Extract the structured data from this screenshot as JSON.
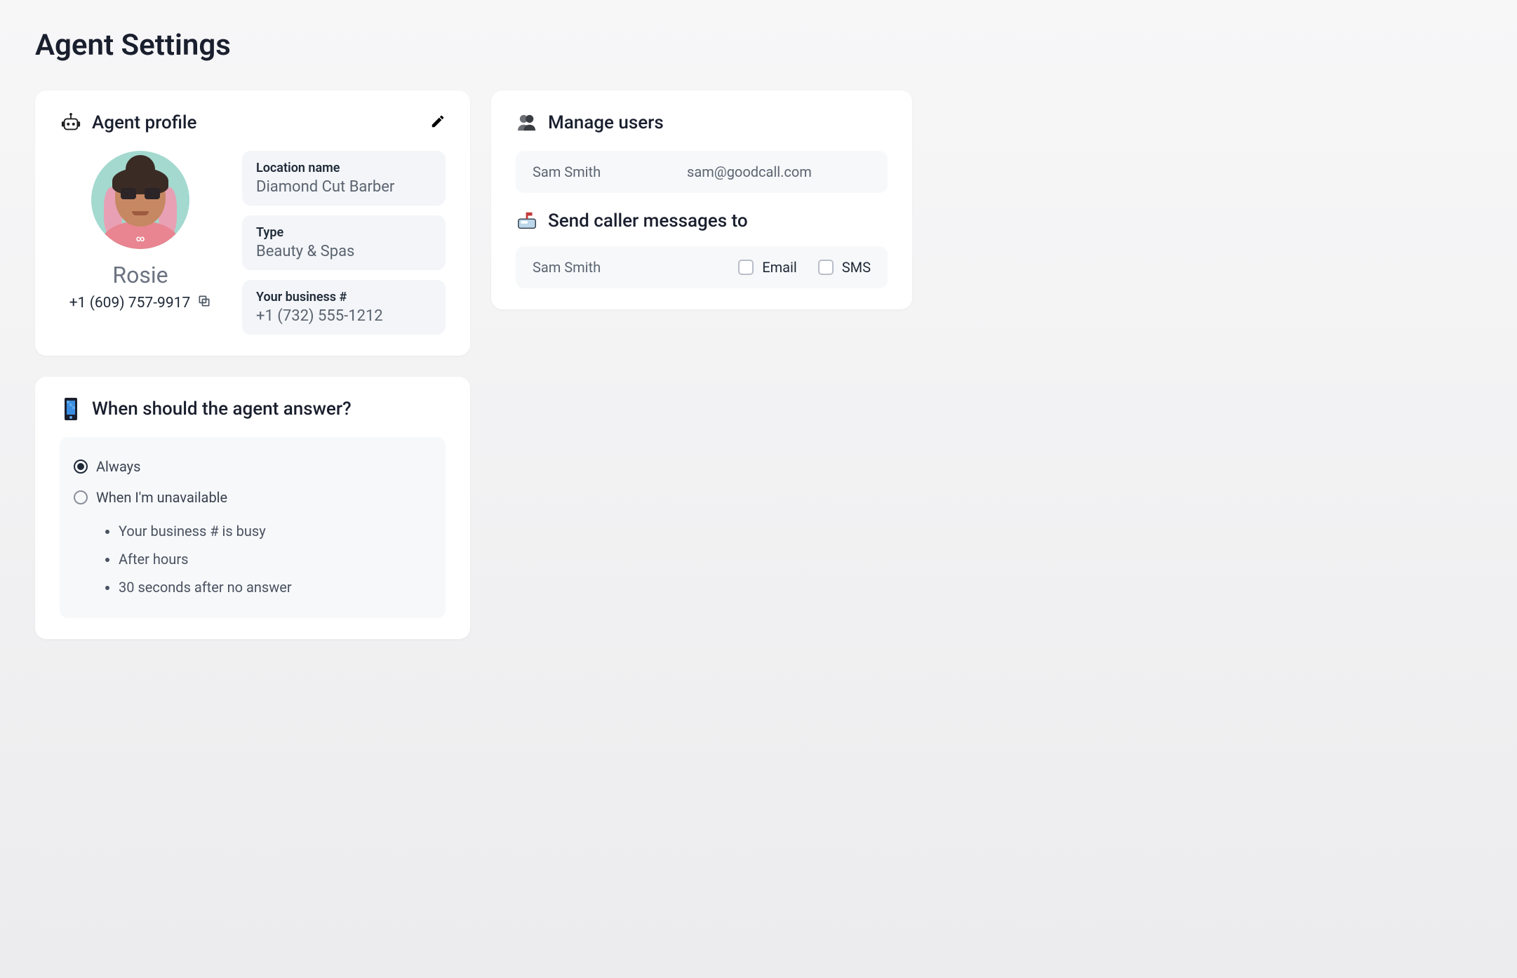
{
  "page": {
    "title": "Agent Settings"
  },
  "profile": {
    "card_title": "Agent profile",
    "agent_name": "Rosie",
    "agent_phone": "+1 (609) 757-9917",
    "fields": {
      "location": {
        "label": "Location name",
        "value": "Diamond Cut Barber"
      },
      "type": {
        "label": "Type",
        "value": "Beauty & Spas"
      },
      "business_number": {
        "label": "Your business #",
        "value": "+1 (732) 555-1212"
      }
    }
  },
  "users": {
    "card_title": "Manage users",
    "rows": [
      {
        "name": "Sam Smith",
        "email": "sam@goodcall.com"
      }
    ]
  },
  "messages": {
    "section_title": "Send caller messages to",
    "rows": [
      {
        "name": "Sam Smith",
        "email_checked": false,
        "sms_checked": false
      }
    ],
    "labels": {
      "email": "Email",
      "sms": "SMS"
    }
  },
  "answer": {
    "card_title": "When should the agent answer?",
    "options": {
      "always": {
        "label": "Always",
        "selected": true
      },
      "unavailable": {
        "label": "When I'm unavailable",
        "selected": false,
        "bullets": [
          "Your business # is busy",
          "After hours",
          "30 seconds after no answer"
        ]
      }
    }
  }
}
